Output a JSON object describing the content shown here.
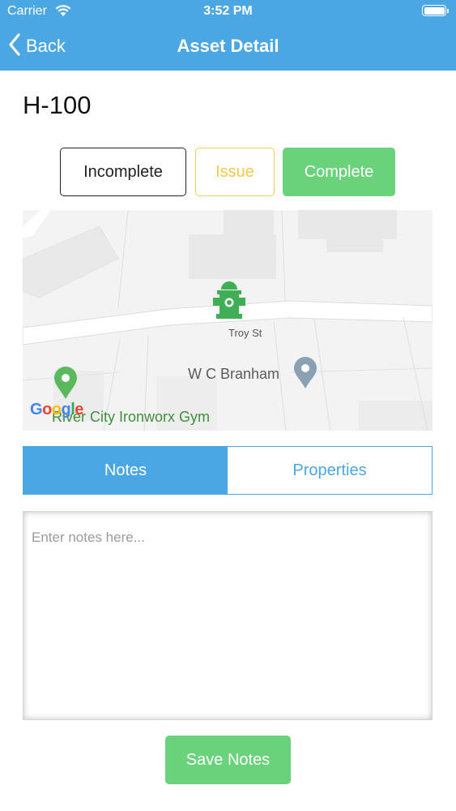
{
  "status_bar": {
    "carrier": "Carrier",
    "time": "3:52 PM"
  },
  "nav": {
    "back_label": "Back",
    "title": "Asset Detail"
  },
  "asset": {
    "id": "H-100"
  },
  "status_options": {
    "incomplete": "Incomplete",
    "issue": "Issue",
    "complete": "Complete"
  },
  "map": {
    "street_label": "Troy St",
    "place_label": "W C Branham",
    "business_label": "River City Ironworx Gym",
    "provider_logo": "Google",
    "marker_icon": "fire-hydrant-icon"
  },
  "tabs": [
    {
      "label": "Notes",
      "active": true
    },
    {
      "label": "Properties",
      "active": false
    }
  ],
  "notes": {
    "placeholder": "Enter notes here...",
    "value": ""
  },
  "save_button": {
    "label": "Save Notes"
  },
  "colors": {
    "nav_blue": "#4ba6e4",
    "complete_green": "#69d27a",
    "issue_yellow": "#f2c94c"
  }
}
